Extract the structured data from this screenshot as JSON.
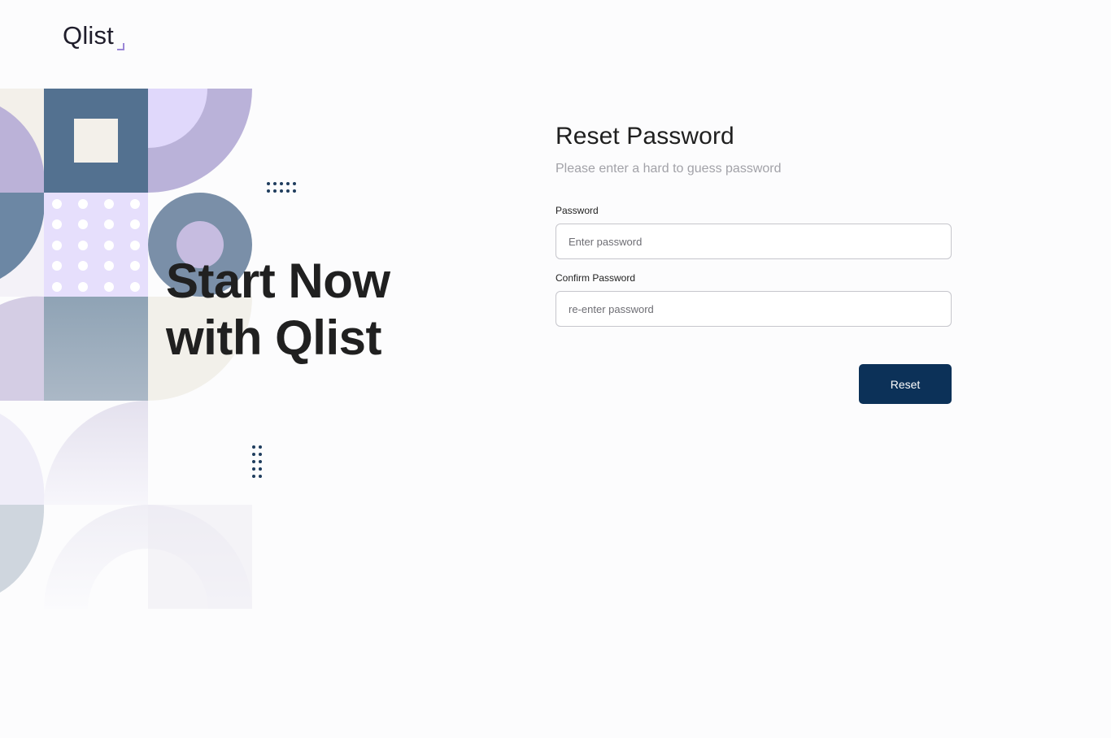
{
  "brand": {
    "logo_text": "Qlist",
    "accent_color": "#9a86d6",
    "primary_color": "#0c3158"
  },
  "hero": {
    "line1": "Start Now",
    "line2": "with Qlist"
  },
  "form": {
    "title": "Reset Password",
    "subtitle": "Please enter a hard to guess password",
    "password_label": "Password",
    "password_placeholder": "Enter password",
    "password_value": "",
    "confirm_label": "Confirm Password",
    "confirm_placeholder": "re-enter password",
    "confirm_value": "",
    "reset_label": "Reset"
  }
}
